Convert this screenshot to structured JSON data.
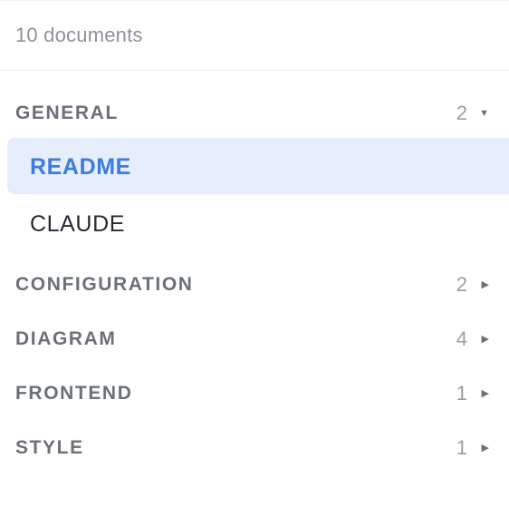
{
  "header": {
    "doc_count": "10 documents"
  },
  "groups": [
    {
      "label": "GENERAL",
      "count": "2",
      "caret": "▼",
      "expanded": true,
      "items": [
        {
          "label": "README",
          "active": true
        },
        {
          "label": "CLAUDE",
          "active": false
        }
      ]
    },
    {
      "label": "CONFIGURATION",
      "count": "2",
      "caret": "▶",
      "expanded": false
    },
    {
      "label": "DIAGRAM",
      "count": "4",
      "caret": "▶",
      "expanded": false
    },
    {
      "label": "FRONTEND",
      "count": "1",
      "caret": "▶",
      "expanded": false
    },
    {
      "label": "STYLE",
      "count": "1",
      "caret": "▶",
      "expanded": false
    }
  ],
  "colors": {
    "active_bg": "#e6eefb",
    "active_text": "#3d7ce0",
    "group_label": "#6b7079",
    "muted": "#8e9299"
  }
}
